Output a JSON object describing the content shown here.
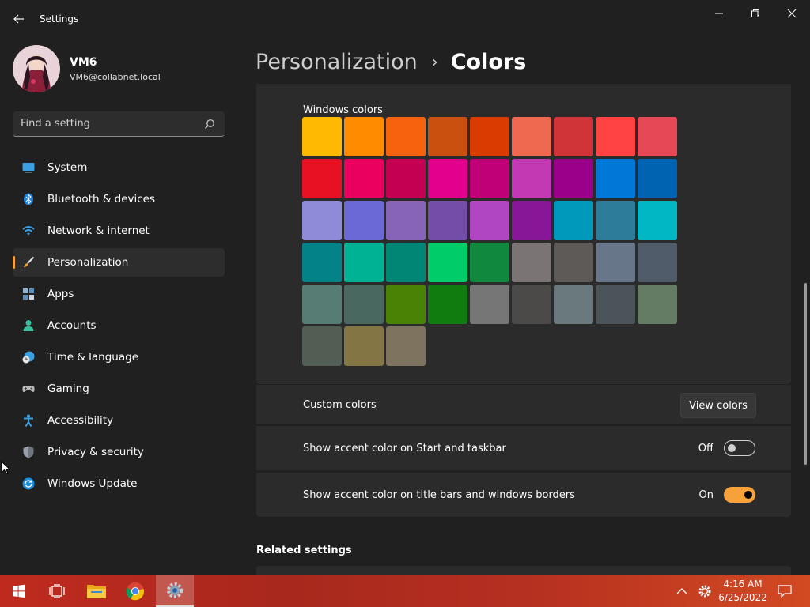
{
  "window": {
    "title": "Settings",
    "controls": [
      "minimize-icon",
      "maximize-icon",
      "close-icon"
    ]
  },
  "profile": {
    "name": "VM6",
    "email": "VM6@collabnet.local"
  },
  "search": {
    "placeholder": "Find a setting"
  },
  "sidebar": {
    "items": [
      {
        "label": "System",
        "icon": "monitor-icon",
        "active": false
      },
      {
        "label": "Bluetooth & devices",
        "icon": "bluetooth-icon",
        "active": false
      },
      {
        "label": "Network & internet",
        "icon": "wifi-icon",
        "active": false
      },
      {
        "label": "Personalization",
        "icon": "paintbrush-icon",
        "active": true
      },
      {
        "label": "Apps",
        "icon": "apps-icon",
        "active": false
      },
      {
        "label": "Accounts",
        "icon": "person-icon",
        "active": false
      },
      {
        "label": "Time & language",
        "icon": "globe-clock-icon",
        "active": false
      },
      {
        "label": "Gaming",
        "icon": "gamepad-icon",
        "active": false
      },
      {
        "label": "Accessibility",
        "icon": "accessibility-icon",
        "active": false
      },
      {
        "label": "Privacy & security",
        "icon": "shield-icon",
        "active": false
      },
      {
        "label": "Windows Update",
        "icon": "refresh-icon",
        "active": false
      }
    ]
  },
  "breadcrumb": {
    "parent": "Personalization",
    "separator": "›",
    "current": "Colors"
  },
  "colors": {
    "section_title": "Windows colors",
    "swatches": [
      "#FFB900",
      "#FF8C00",
      "#F7630C",
      "#CA5010",
      "#DA3B01",
      "#EF6950",
      "#D13438",
      "#FF4343",
      "#E74856",
      "#E81123",
      "#EA005E",
      "#C30052",
      "#E3008C",
      "#BF0077",
      "#C239B3",
      "#9A0089",
      "#0078D7",
      "#0063B1",
      "#8E8CD8",
      "#6B69D6",
      "#8764B8",
      "#744DA9",
      "#B146C2",
      "#881798",
      "#0099BC",
      "#2D7D9A",
      "#00B7C3",
      "#038387",
      "#00B294",
      "#018574",
      "#00CC6A",
      "#10893E",
      "#7A7574",
      "#5D5A58",
      "#68768A",
      "#515C6B",
      "#567C73",
      "#486860",
      "#498205",
      "#107C10",
      "#767676",
      "#4C4A48",
      "#69797E",
      "#4A5459",
      "#647C64",
      "#525E54",
      "#847545",
      "#7E735F"
    ]
  },
  "custom_colors": {
    "label": "Custom colors",
    "button": "View colors"
  },
  "accent_start": {
    "label": "Show accent color on Start and taskbar",
    "state": "Off"
  },
  "accent_titlebars": {
    "label": "Show accent color on title bars and windows borders",
    "state": "On"
  },
  "related": {
    "title": "Related settings"
  },
  "taskbar": {
    "time": "4:16 AM",
    "date": "6/25/2022",
    "accent": "#f7a13b"
  }
}
